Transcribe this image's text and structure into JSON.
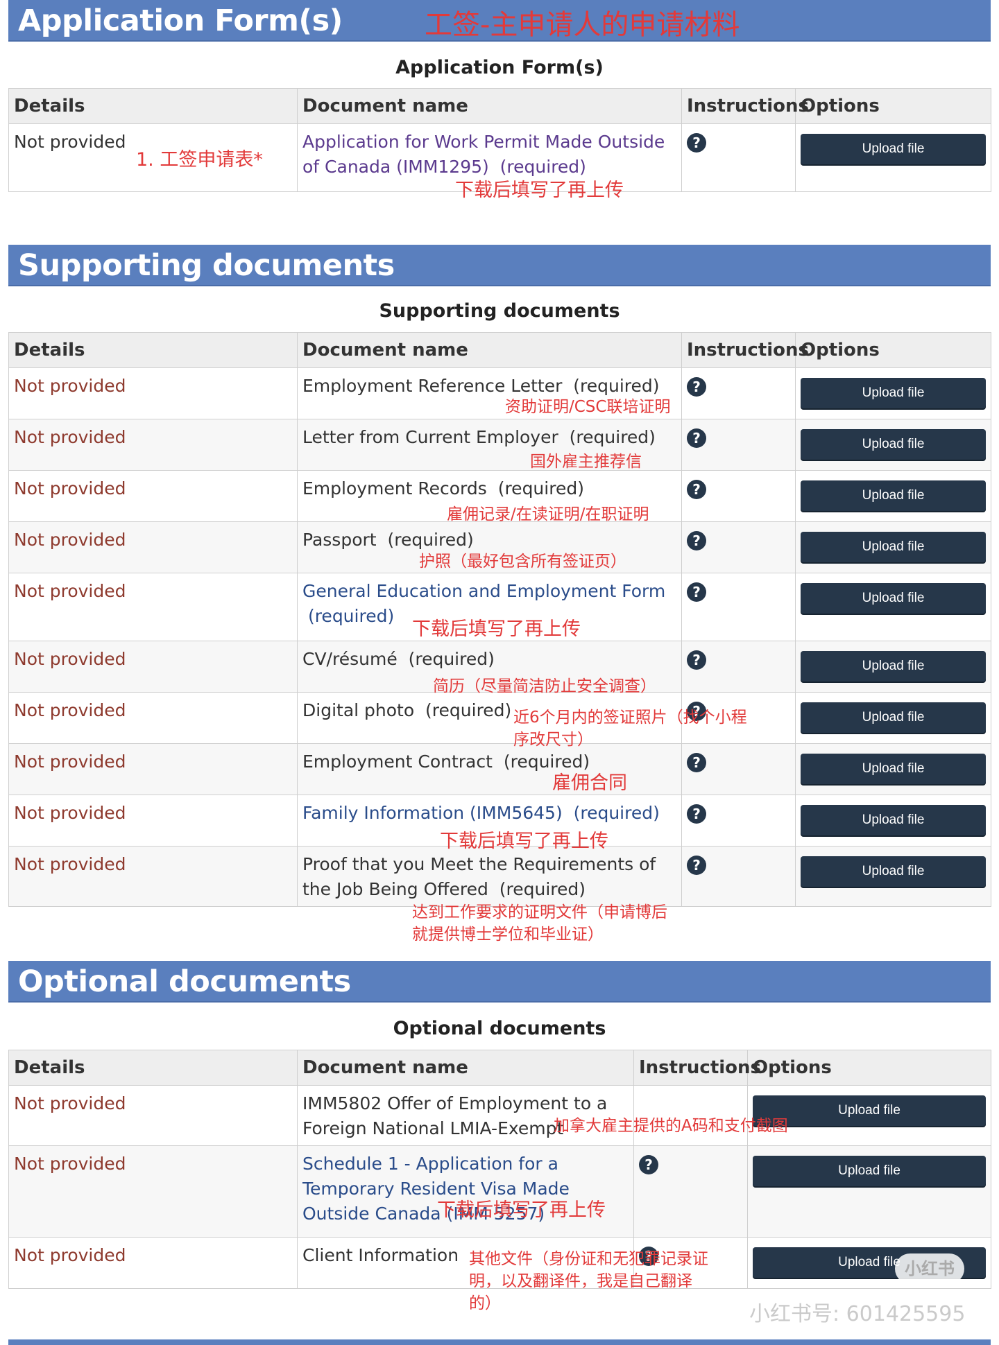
{
  "sections": {
    "forms": {
      "heading": "Application Form(s)",
      "caption": "Application Form(s)",
      "headers": [
        "Details",
        "Document name",
        "Instructions",
        "Options"
      ],
      "rows": [
        {
          "details": "Not provided",
          "doc": "Application for Work Permit Made Outside of Canada (IMM1295)",
          "req": "(required)",
          "button": "Upload file"
        }
      ]
    },
    "supporting": {
      "heading": "Supporting documents",
      "caption": "Supporting documents",
      "headers": [
        "Details",
        "Document name",
        "Instructions",
        "Options"
      ],
      "rows": [
        {
          "details": "Not provided",
          "doc": "Employment Reference Letter",
          "req": "(required)",
          "button": "Upload file"
        },
        {
          "details": "Not provided",
          "doc": "Letter from Current Employer",
          "req": "(required)",
          "button": "Upload file"
        },
        {
          "details": "Not provided",
          "doc": "Employment Records",
          "req": "(required)",
          "button": "Upload file"
        },
        {
          "details": "Not provided",
          "doc": "Passport",
          "req": "(required)",
          "button": "Upload file"
        },
        {
          "details": "Not provided",
          "doc": "General Education and Employment Form",
          "req": "(required)",
          "button": "Upload file"
        },
        {
          "details": "Not provided",
          "doc": "CV/résumé",
          "req": "(required)",
          "button": "Upload file"
        },
        {
          "details": "Not provided",
          "doc": "Digital photo",
          "req": "(required)",
          "button": "Upload file"
        },
        {
          "details": "Not provided",
          "doc": "Employment Contract",
          "req": "(required)",
          "button": "Upload file"
        },
        {
          "details": "Not provided",
          "doc": "Family Information (IMM5645)",
          "req": "(required)",
          "button": "Upload file"
        },
        {
          "details": "Not provided",
          "doc": "Proof that you Meet the Requirements of the Job Being Offered",
          "req": "(required)",
          "button": "Upload file"
        }
      ]
    },
    "optional": {
      "heading": "Optional documents",
      "caption": "Optional documents",
      "headers": [
        "Details",
        "Document name",
        "Instructions",
        "Options"
      ],
      "rows": [
        {
          "details": "Not provided",
          "doc": "IMM5802 Offer of Employment to a Foreign National LMIA-Exempt",
          "button": "Upload file"
        },
        {
          "details": "Not provided",
          "doc": "Schedule 1 - Application for a Temporary Resident Visa Made Outside Canada (IMM 5257)",
          "button": "Upload file"
        },
        {
          "details": "Not provided",
          "doc": "Client Information",
          "button": "Upload file"
        }
      ]
    }
  },
  "annotations": {
    "title": "工签-主申请人的申请材料",
    "a1": "1. 工签申请表*",
    "a2": "下载后填写了再上传",
    "s1": "资助证明/CSC联培证明",
    "s2": "国外雇主推荐信",
    "s3": "雇佣记录/在读证明/在职证明",
    "s4": "护照（最好包含所有签证页）",
    "s5": "下载后填写了再上传",
    "s6": "简历（尽量简洁防止安全调查）",
    "s7": "近6个月内的签证照片（找个小程序改尺寸）",
    "s8": "雇佣合同",
    "s9": "下载后填写了再上传",
    "s10": "达到工作要求的证明文件（申请博后就提供博士学位和毕业证）",
    "o1": "加拿大雇主提供的A码和支付截图",
    "o2": "下载后填写了再上传",
    "o3": "其他文件（身份证和无犯罪记录证明，以及翻译件，我是自己翻译的）"
  },
  "watermark": {
    "logo": "小红书",
    "text": "小红书号: 601425595"
  },
  "icons": {
    "help": "question-circle-icon"
  },
  "colors": {
    "bar": "#5a7fbe",
    "button": "#26374a",
    "annotation": "#e23a3a",
    "not_provided": "#8e3a2e"
  }
}
